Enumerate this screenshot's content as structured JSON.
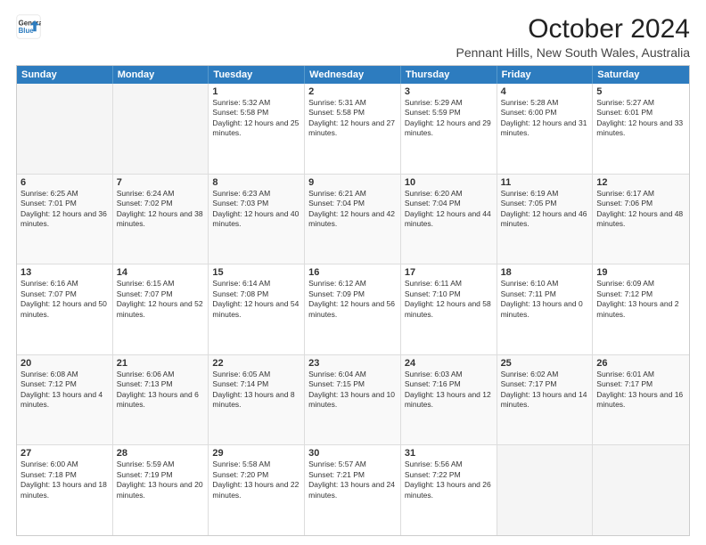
{
  "header": {
    "logo_line1": "General",
    "logo_line2": "Blue",
    "main_title": "October 2024",
    "subtitle": "Pennant Hills, New South Wales, Australia"
  },
  "weekdays": [
    "Sunday",
    "Monday",
    "Tuesday",
    "Wednesday",
    "Thursday",
    "Friday",
    "Saturday"
  ],
  "rows": [
    [
      {
        "day": "",
        "sunrise": "",
        "sunset": "",
        "daylight": ""
      },
      {
        "day": "",
        "sunrise": "",
        "sunset": "",
        "daylight": ""
      },
      {
        "day": "1",
        "sunrise": "Sunrise: 5:32 AM",
        "sunset": "Sunset: 5:58 PM",
        "daylight": "Daylight: 12 hours and 25 minutes."
      },
      {
        "day": "2",
        "sunrise": "Sunrise: 5:31 AM",
        "sunset": "Sunset: 5:58 PM",
        "daylight": "Daylight: 12 hours and 27 minutes."
      },
      {
        "day": "3",
        "sunrise": "Sunrise: 5:29 AM",
        "sunset": "Sunset: 5:59 PM",
        "daylight": "Daylight: 12 hours and 29 minutes."
      },
      {
        "day": "4",
        "sunrise": "Sunrise: 5:28 AM",
        "sunset": "Sunset: 6:00 PM",
        "daylight": "Daylight: 12 hours and 31 minutes."
      },
      {
        "day": "5",
        "sunrise": "Sunrise: 5:27 AM",
        "sunset": "Sunset: 6:01 PM",
        "daylight": "Daylight: 12 hours and 33 minutes."
      }
    ],
    [
      {
        "day": "6",
        "sunrise": "Sunrise: 6:25 AM",
        "sunset": "Sunset: 7:01 PM",
        "daylight": "Daylight: 12 hours and 36 minutes."
      },
      {
        "day": "7",
        "sunrise": "Sunrise: 6:24 AM",
        "sunset": "Sunset: 7:02 PM",
        "daylight": "Daylight: 12 hours and 38 minutes."
      },
      {
        "day": "8",
        "sunrise": "Sunrise: 6:23 AM",
        "sunset": "Sunset: 7:03 PM",
        "daylight": "Daylight: 12 hours and 40 minutes."
      },
      {
        "day": "9",
        "sunrise": "Sunrise: 6:21 AM",
        "sunset": "Sunset: 7:04 PM",
        "daylight": "Daylight: 12 hours and 42 minutes."
      },
      {
        "day": "10",
        "sunrise": "Sunrise: 6:20 AM",
        "sunset": "Sunset: 7:04 PM",
        "daylight": "Daylight: 12 hours and 44 minutes."
      },
      {
        "day": "11",
        "sunrise": "Sunrise: 6:19 AM",
        "sunset": "Sunset: 7:05 PM",
        "daylight": "Daylight: 12 hours and 46 minutes."
      },
      {
        "day": "12",
        "sunrise": "Sunrise: 6:17 AM",
        "sunset": "Sunset: 7:06 PM",
        "daylight": "Daylight: 12 hours and 48 minutes."
      }
    ],
    [
      {
        "day": "13",
        "sunrise": "Sunrise: 6:16 AM",
        "sunset": "Sunset: 7:07 PM",
        "daylight": "Daylight: 12 hours and 50 minutes."
      },
      {
        "day": "14",
        "sunrise": "Sunrise: 6:15 AM",
        "sunset": "Sunset: 7:07 PM",
        "daylight": "Daylight: 12 hours and 52 minutes."
      },
      {
        "day": "15",
        "sunrise": "Sunrise: 6:14 AM",
        "sunset": "Sunset: 7:08 PM",
        "daylight": "Daylight: 12 hours and 54 minutes."
      },
      {
        "day": "16",
        "sunrise": "Sunrise: 6:12 AM",
        "sunset": "Sunset: 7:09 PM",
        "daylight": "Daylight: 12 hours and 56 minutes."
      },
      {
        "day": "17",
        "sunrise": "Sunrise: 6:11 AM",
        "sunset": "Sunset: 7:10 PM",
        "daylight": "Daylight: 12 hours and 58 minutes."
      },
      {
        "day": "18",
        "sunrise": "Sunrise: 6:10 AM",
        "sunset": "Sunset: 7:11 PM",
        "daylight": "Daylight: 13 hours and 0 minutes."
      },
      {
        "day": "19",
        "sunrise": "Sunrise: 6:09 AM",
        "sunset": "Sunset: 7:12 PM",
        "daylight": "Daylight: 13 hours and 2 minutes."
      }
    ],
    [
      {
        "day": "20",
        "sunrise": "Sunrise: 6:08 AM",
        "sunset": "Sunset: 7:12 PM",
        "daylight": "Daylight: 13 hours and 4 minutes."
      },
      {
        "day": "21",
        "sunrise": "Sunrise: 6:06 AM",
        "sunset": "Sunset: 7:13 PM",
        "daylight": "Daylight: 13 hours and 6 minutes."
      },
      {
        "day": "22",
        "sunrise": "Sunrise: 6:05 AM",
        "sunset": "Sunset: 7:14 PM",
        "daylight": "Daylight: 13 hours and 8 minutes."
      },
      {
        "day": "23",
        "sunrise": "Sunrise: 6:04 AM",
        "sunset": "Sunset: 7:15 PM",
        "daylight": "Daylight: 13 hours and 10 minutes."
      },
      {
        "day": "24",
        "sunrise": "Sunrise: 6:03 AM",
        "sunset": "Sunset: 7:16 PM",
        "daylight": "Daylight: 13 hours and 12 minutes."
      },
      {
        "day": "25",
        "sunrise": "Sunrise: 6:02 AM",
        "sunset": "Sunset: 7:17 PM",
        "daylight": "Daylight: 13 hours and 14 minutes."
      },
      {
        "day": "26",
        "sunrise": "Sunrise: 6:01 AM",
        "sunset": "Sunset: 7:17 PM",
        "daylight": "Daylight: 13 hours and 16 minutes."
      }
    ],
    [
      {
        "day": "27",
        "sunrise": "Sunrise: 6:00 AM",
        "sunset": "Sunset: 7:18 PM",
        "daylight": "Daylight: 13 hours and 18 minutes."
      },
      {
        "day": "28",
        "sunrise": "Sunrise: 5:59 AM",
        "sunset": "Sunset: 7:19 PM",
        "daylight": "Daylight: 13 hours and 20 minutes."
      },
      {
        "day": "29",
        "sunrise": "Sunrise: 5:58 AM",
        "sunset": "Sunset: 7:20 PM",
        "daylight": "Daylight: 13 hours and 22 minutes."
      },
      {
        "day": "30",
        "sunrise": "Sunrise: 5:57 AM",
        "sunset": "Sunset: 7:21 PM",
        "daylight": "Daylight: 13 hours and 24 minutes."
      },
      {
        "day": "31",
        "sunrise": "Sunrise: 5:56 AM",
        "sunset": "Sunset: 7:22 PM",
        "daylight": "Daylight: 13 hours and 26 minutes."
      },
      {
        "day": "",
        "sunrise": "",
        "sunset": "",
        "daylight": ""
      },
      {
        "day": "",
        "sunrise": "",
        "sunset": "",
        "daylight": ""
      }
    ]
  ]
}
